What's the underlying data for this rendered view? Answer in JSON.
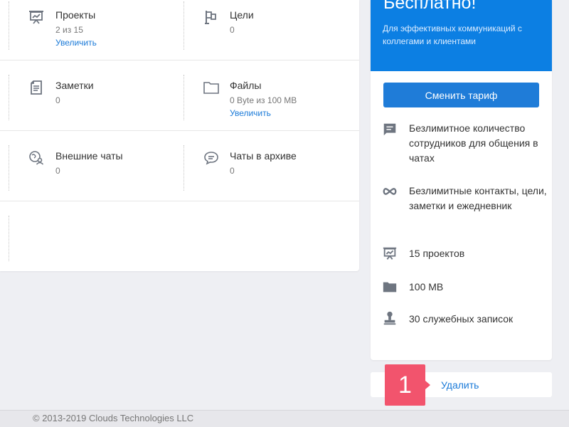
{
  "stats": {
    "rows": [
      [
        {
          "icon": "presentation-icon",
          "title": "Проекты",
          "value": "2 из 15",
          "link": "Увеличить"
        },
        {
          "icon": "flag-icon",
          "title": "Цели",
          "value": "0",
          "link": ""
        }
      ],
      [
        {
          "icon": "note-icon",
          "title": "Заметки",
          "value": "0",
          "link": ""
        },
        {
          "icon": "folder-icon",
          "title": "Файлы",
          "value": "0 Byte из 100 MB",
          "link": "Увеличить"
        }
      ],
      [
        {
          "icon": "external-chat-icon",
          "title": "Внешние чаты",
          "value": "0",
          "link": ""
        },
        {
          "icon": "chat-archive-icon",
          "title": "Чаты в архиве",
          "value": "0",
          "link": ""
        }
      ]
    ]
  },
  "plan": {
    "title": "Бесплатно!",
    "subtitle": "Для эффективных коммуникаций с коллегами и клиентами",
    "button": "Сменить тариф",
    "features": [
      {
        "icon": "message-icon",
        "text": "Безлимитное количество сотрудников для общения в чатах"
      },
      {
        "icon": "infinity-icon",
        "text": "Безлимитные контакты, цели, заметки и ежедневник"
      },
      {
        "icon": "presentation-icon",
        "text": "15 проектов"
      },
      {
        "icon": "folder-icon",
        "text": "100 MB"
      },
      {
        "icon": "stamp-icon",
        "text": "30 служебных записок"
      }
    ]
  },
  "delete": {
    "link": "Удалить",
    "badge": "1"
  },
  "footer": {
    "text": "© 2013-2019 Clouds Technologies LLC"
  },
  "colors": {
    "accent": "#0c7fe3",
    "button": "#1f7cd8",
    "link": "#1a7ad8",
    "badge": "#f2546d",
    "icon": "#6e7580"
  }
}
